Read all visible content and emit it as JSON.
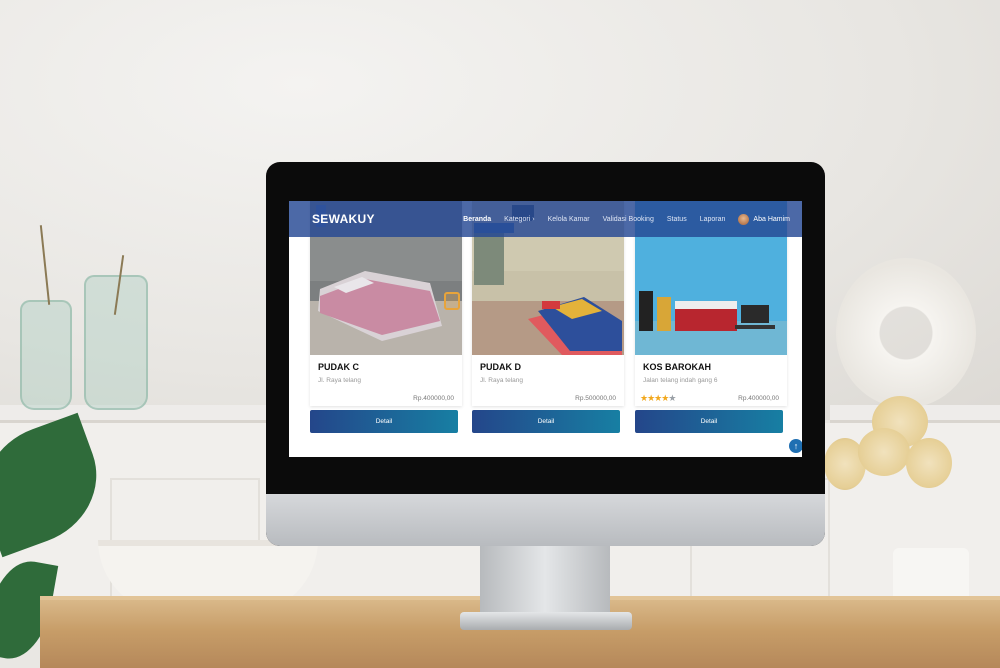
{
  "navbar": {
    "brand": "SEWAKUY",
    "links": [
      {
        "label": "Beranda",
        "active": true
      },
      {
        "label": "Kategori",
        "has_dropdown": true
      },
      {
        "label": "Kelola Kamar"
      },
      {
        "label": "Validasi Booking"
      },
      {
        "label": "Status"
      },
      {
        "label": "Laporan"
      }
    ],
    "user": {
      "name": "Aba Hamim"
    }
  },
  "cards": [
    {
      "title": "PUDAK C",
      "address": "Jl. Raya telang",
      "price": "Rp.400000,00",
      "button": "Detail"
    },
    {
      "title": "PUDAK D",
      "address": "Jl. Raya telang",
      "price": "Rp.500000,00",
      "button": "Detail"
    },
    {
      "title": "KOS BAROKAH",
      "address": "Jalan telang indah gang 6",
      "price": "Rp.400000,00",
      "button": "Detail",
      "rating": 4,
      "rating_max": 5
    }
  ],
  "colors": {
    "navbar": "#254894",
    "button_start": "#24468a",
    "button_end": "#177fa3",
    "star": "#f2a81d"
  },
  "icons": {
    "scroll_top": "arrow-up-icon",
    "dropdown": "chevron-right-icon"
  }
}
